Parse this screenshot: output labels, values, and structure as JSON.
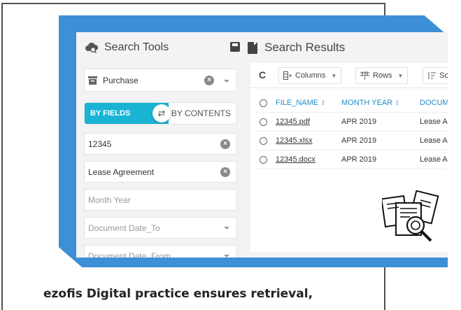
{
  "search_tools": {
    "title": "Search Tools",
    "repository": "Purchase",
    "toggle_left": "BY FIELDS",
    "toggle_right": "BY CONTENTS",
    "toggle_glyph": "⇄",
    "clear_glyph": "×",
    "fields": [
      {
        "value": "12345"
      },
      {
        "value": "Lease Agreement"
      },
      {
        "placeholder": "Month Year"
      },
      {
        "placeholder": "Document Date_To"
      },
      {
        "placeholder": "Document Date_From"
      }
    ]
  },
  "search_results": {
    "title": "Search Results",
    "toolbar": {
      "refresh": "C",
      "columns": "Columns",
      "rows": "Rows",
      "sort": "So"
    },
    "columns": [
      "FILE_NAME",
      "MONTH YEAR",
      "DOCUM"
    ],
    "rows": [
      {
        "file": "12345.pdf",
        "month": "APR 2019",
        "doc": "Lease A"
      },
      {
        "file": "12345.xlsx",
        "month": "APR 2019",
        "doc": "Lease A"
      },
      {
        "file": "12345.docx",
        "month": "APR 2019",
        "doc": "Lease A"
      }
    ]
  },
  "caption": "ezofis Digital practice ensures retrieval,",
  "colors": {
    "accent": "#19b4d4",
    "brand_blue": "#3d8fd7",
    "link": "#1e8ecf"
  },
  "icons": [
    "cloud-search-icon",
    "save-icon",
    "document-icon",
    "refresh-icon",
    "columns-icon",
    "rows-icon",
    "sort-icon",
    "documents-search-illustration"
  ]
}
